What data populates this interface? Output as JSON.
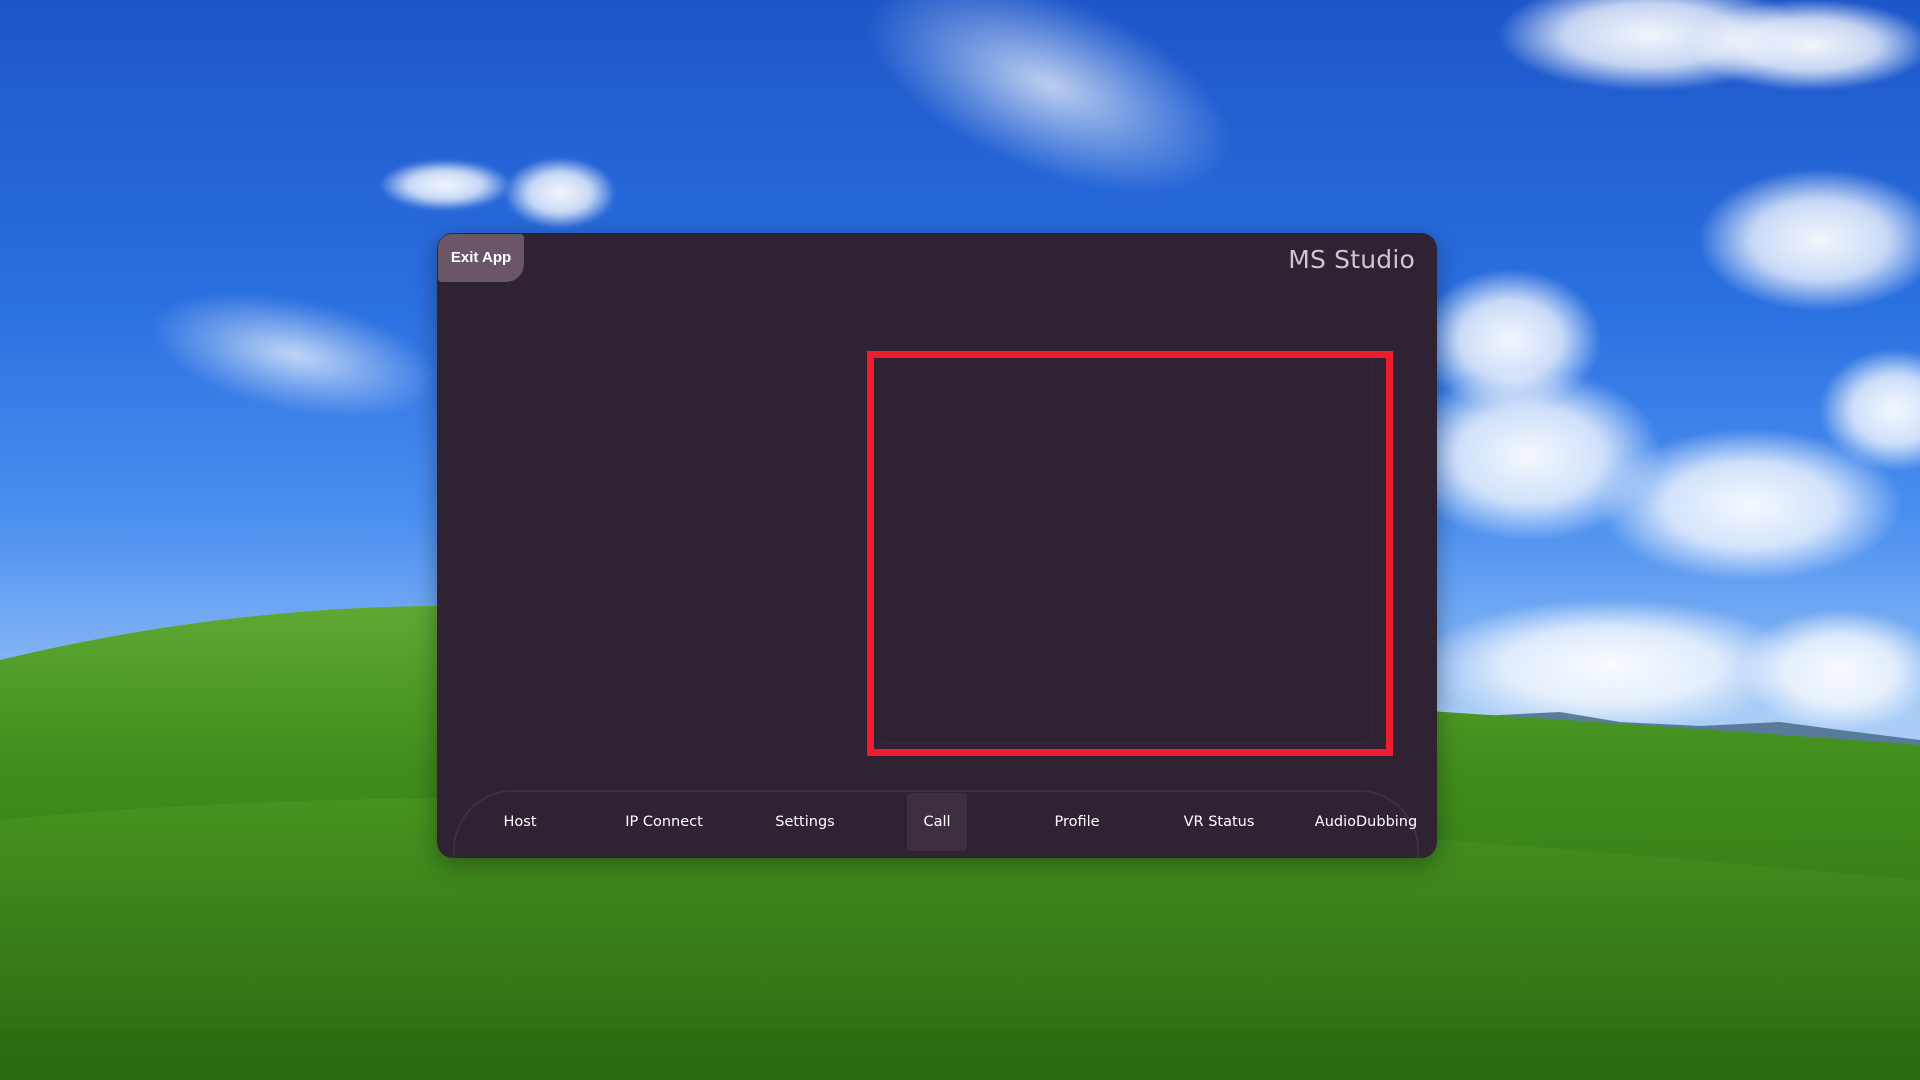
{
  "window": {
    "exit_label": "Exit App",
    "title": "MS Studio"
  },
  "nav": {
    "items": [
      {
        "label": "Host"
      },
      {
        "label": "IP Connect"
      },
      {
        "label": "Settings"
      },
      {
        "label": "Call",
        "active": true
      },
      {
        "label": "Profile"
      },
      {
        "label": "VR Status"
      },
      {
        "label": "AudioDubbing"
      }
    ]
  },
  "colors": {
    "window_bg": "#2e2233",
    "exit_button_bg": "#6a5666",
    "highlight": "#ee1c2e",
    "active_tab_bg": "#3d2f40"
  }
}
